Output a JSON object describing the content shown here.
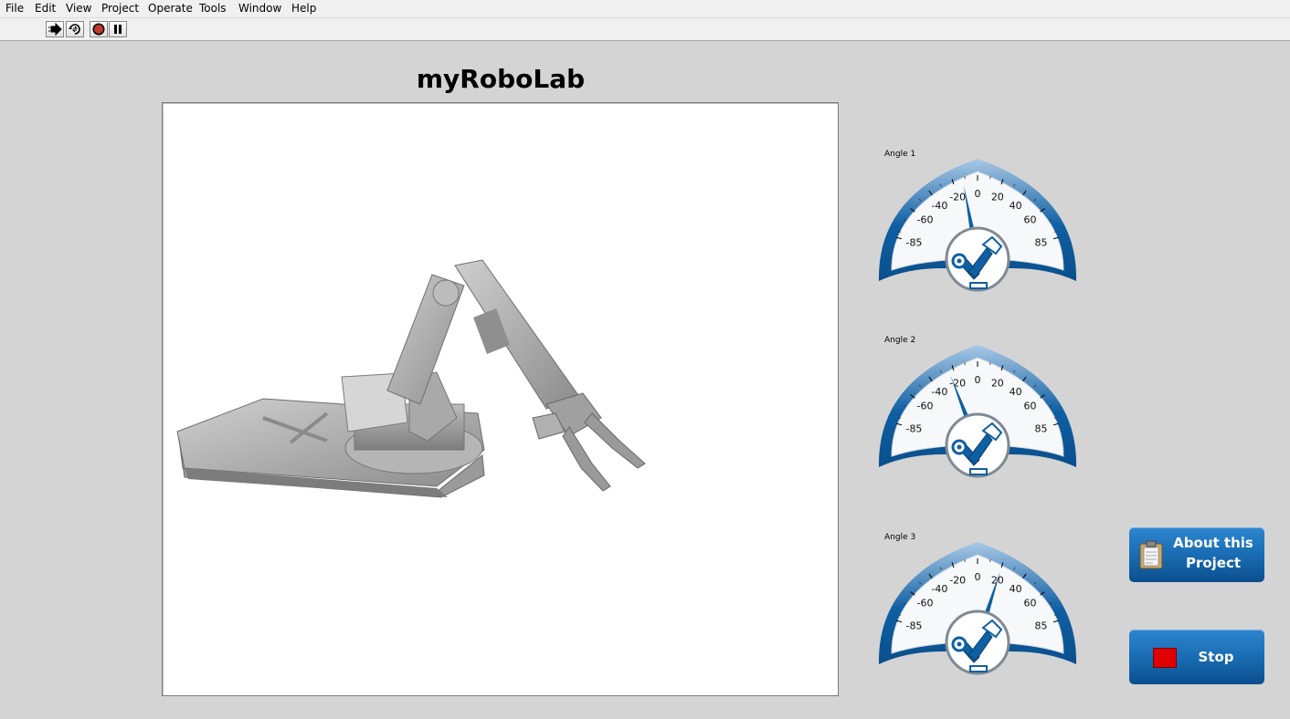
{
  "menu": [
    "File",
    "Edit",
    "View",
    "Project",
    "Operate",
    "Tools",
    "Window",
    "Help"
  ],
  "toolbar": {
    "run_icon": "run-arrow-icon",
    "run_continuously_icon": "run-continuously-icon",
    "abort_icon": "abort-stop-icon",
    "pause_icon": "pause-icon"
  },
  "page_title": "myRoboLab",
  "gauges": [
    {
      "label": "Angle 1",
      "value": -12,
      "ticks": [
        "-85",
        "-60",
        "-40",
        "-20",
        "0",
        "20",
        "40",
        "60",
        "85"
      ]
    },
    {
      "label": "Angle 2",
      "value": -24,
      "ticks": [
        "-85",
        "-60",
        "-40",
        "-20",
        "0",
        "20",
        "40",
        "60",
        "85"
      ]
    },
    {
      "label": "Angle 3",
      "value": 20,
      "ticks": [
        "-85",
        "-60",
        "-40",
        "-20",
        "0",
        "20",
        "40",
        "60",
        "85"
      ]
    }
  ],
  "buttons": {
    "about_line1": "About this",
    "about_line2": "Project",
    "stop": "Stop"
  },
  "colors": {
    "gauge_blue": "#0f5fa3",
    "button_blue": "#1b6fb6",
    "stop_red": "#e00000"
  }
}
